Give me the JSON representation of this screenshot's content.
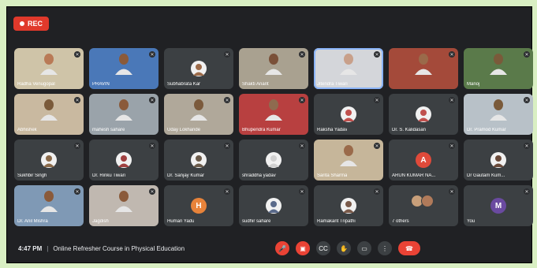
{
  "rec_label": "REC",
  "tiles": [
    {
      "name": "Radha Venugopal",
      "kind": "video",
      "skin": "#b97a56",
      "bg": "#cfc4a8"
    },
    {
      "name": "PRAVIN",
      "kind": "video",
      "skin": "#8a5a3a",
      "bg": "#4a78b8"
    },
    {
      "name": "Subhabrata Kar",
      "kind": "avatar-photo",
      "skin": "#9c6b4a"
    },
    {
      "name": "Shakti Anant",
      "kind": "video",
      "skin": "#7a5038",
      "bg": "#a9a190"
    },
    {
      "name": "Jitendra Tiwari",
      "kind": "video",
      "skin": "#c8a08a",
      "bg": "#d4d6da",
      "active": true
    },
    {
      "name": "",
      "kind": "video",
      "skin": "#9a6a4a",
      "bg": "#a44a3a"
    },
    {
      "name": "Manoj",
      "kind": "video",
      "skin": "#7a5a3a",
      "bg": "#5a7a4a"
    },
    {
      "name": "Abhishek",
      "kind": "video",
      "skin": "#7a5a3a",
      "bg": "#c9b9a0"
    },
    {
      "name": "mahesh sahare",
      "kind": "video",
      "skin": "#8a5a3a",
      "bg": "#9aa3aa"
    },
    {
      "name": "Uday Lokhande",
      "kind": "video",
      "skin": "#7b5a3c",
      "bg": "#b0a89a"
    },
    {
      "name": "Bhupendra Kumar",
      "kind": "video",
      "skin": "#8f6b4f",
      "bg": "#b84040"
    },
    {
      "name": "Raksha Yadav",
      "kind": "avatar-photo",
      "skin": "#c0504d"
    },
    {
      "name": "Dr. S. Kalidasan",
      "kind": "avatar-photo",
      "skin": "#c0504d"
    },
    {
      "name": "Dr. Pramod Kumar",
      "kind": "video",
      "skin": "#7a5a3a",
      "bg": "#b8c1c8"
    },
    {
      "name": "Sukhbir Singh",
      "kind": "avatar-photo",
      "skin": "#8a6a4a"
    },
    {
      "name": "Dr. Rinku Tiwari",
      "kind": "avatar-photo",
      "skin": "#a04040"
    },
    {
      "name": "Dr. Sanjay Kumar",
      "kind": "avatar-photo",
      "skin": "#6a5a4a"
    },
    {
      "name": "shraddha yadav",
      "kind": "avatar-photo",
      "skin": "#d0d0d0"
    },
    {
      "name": "Sarita Sharma",
      "kind": "video",
      "skin": "#9a6a4a",
      "bg": "#c6b69a"
    },
    {
      "name": "ARUN KUMAR NA...",
      "kind": "letter",
      "letter": "A",
      "color": "#e04a3a"
    },
    {
      "name": "Dr Gautam Kum...",
      "kind": "avatar-photo",
      "skin": "#6a4a3a"
    },
    {
      "name": "Dr. Anil Mishra",
      "kind": "video",
      "skin": "#8a5a3a",
      "bg": "#7f99b5"
    },
    {
      "name": "Jagdish",
      "kind": "video",
      "skin": "#8a5a3a",
      "bg": "#c0b8b0"
    },
    {
      "name": "Human Yadu",
      "kind": "letter",
      "letter": "H",
      "color": "#e8833a"
    },
    {
      "name": "sudhir sahare",
      "kind": "avatar-photo",
      "skin": "#5a6a8a"
    },
    {
      "name": "Ramakant Tripathi",
      "kind": "avatar-photo",
      "skin": "#7a5a4a"
    },
    {
      "name": "7 others",
      "kind": "others"
    },
    {
      "name": "You",
      "kind": "letter",
      "letter": "M",
      "color": "#6a4aa0"
    }
  ],
  "bottom": {
    "time": "4:47 PM",
    "separator": "|",
    "meeting": "Online Refresher Course in Physical Education"
  },
  "controls": [
    {
      "icon": "mic-off-icon",
      "glyph": "🎤",
      "style": "red"
    },
    {
      "icon": "camera-off-icon",
      "glyph": "▣",
      "style": "red"
    },
    {
      "icon": "captions-icon",
      "glyph": "CC",
      "style": "normal"
    },
    {
      "icon": "raise-hand-icon",
      "glyph": "✋",
      "style": "normal"
    },
    {
      "icon": "present-icon",
      "glyph": "▭",
      "style": "normal"
    },
    {
      "icon": "more-options-icon",
      "glyph": "⋮",
      "style": "normal"
    },
    {
      "icon": "end-call-icon",
      "glyph": "☎",
      "style": "end"
    }
  ]
}
